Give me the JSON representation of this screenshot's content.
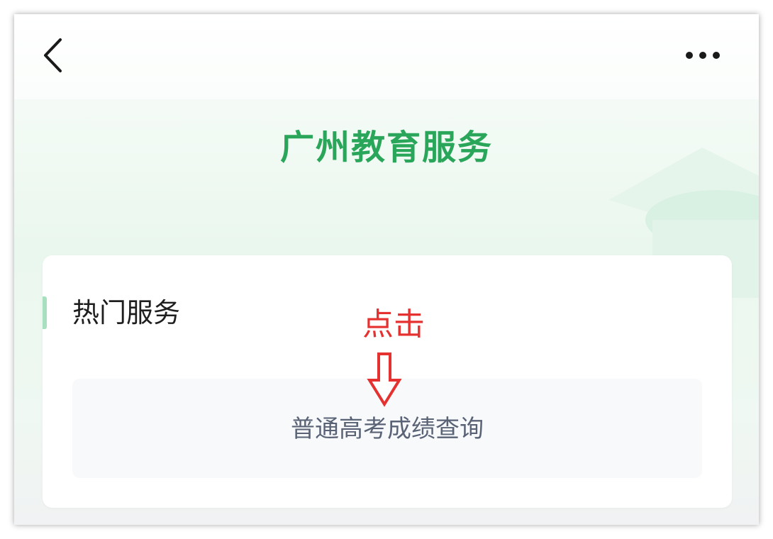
{
  "header": {
    "back_icon": "chevron-left-icon",
    "more_icon": "more-horizontal-icon"
  },
  "page": {
    "title": "广州教育服务",
    "title_color": "#2aa65a"
  },
  "hot_services": {
    "section_title": "热门服务",
    "items": [
      {
        "label": "普通高考成绩查询"
      }
    ]
  },
  "annotation": {
    "text": "点击",
    "color": "#e5312f",
    "arrow_icon": "arrow-down-outline-icon"
  }
}
